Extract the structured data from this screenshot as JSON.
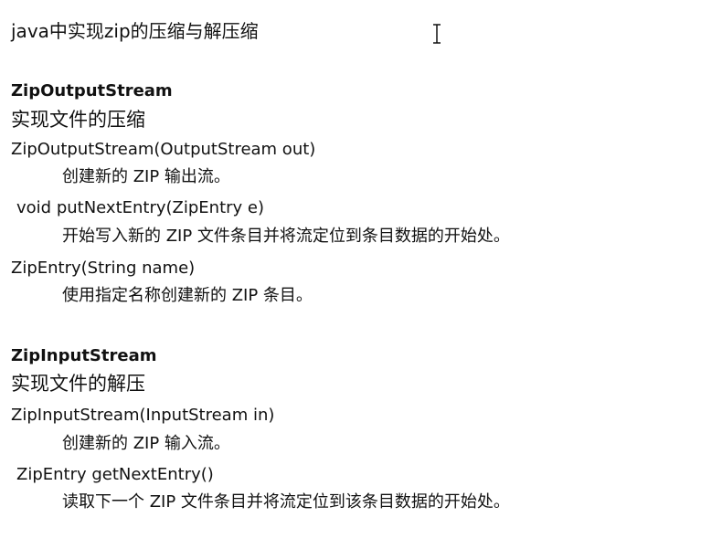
{
  "document": {
    "title": "java中实现zip的压缩与解压缩",
    "sections": [
      {
        "heading": "ZipOutputStream",
        "description": "实现文件的压缩",
        "entries": [
          {
            "signature": "ZipOutputStream(OutputStream out)",
            "note": "创建新的 ZIP 输出流。"
          },
          {
            "signature": "void putNextEntry(ZipEntry e)",
            "note": "开始写入新的 ZIP 文件条目并将流定位到条目数据的开始处。"
          },
          {
            "signature": "ZipEntry(String name)",
            "note": "使用指定名称创建新的 ZIP 条目。"
          }
        ]
      },
      {
        "heading": "ZipInputStream",
        "description": "实现文件的解压",
        "entries": [
          {
            "signature": "ZipInputStream(InputStream in)",
            "note": "创建新的 ZIP 输入流。"
          },
          {
            "signature": "ZipEntry getNextEntry()",
            "note": "读取下一个 ZIP 文件条目并将流定位到该条目数据的开始处。"
          }
        ]
      }
    ]
  },
  "cursor": {
    "icon": "text-cursor-icon"
  }
}
